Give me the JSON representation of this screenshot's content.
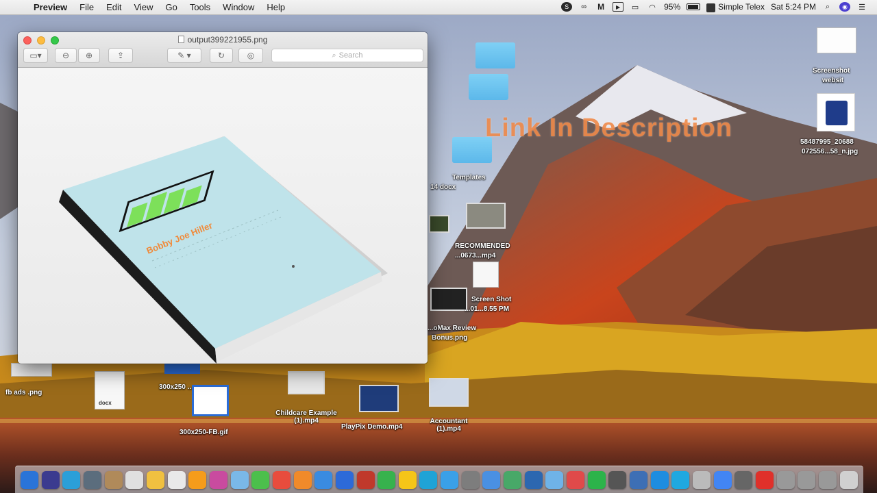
{
  "menubar": {
    "items": [
      "Preview",
      "File",
      "Edit",
      "View",
      "Go",
      "Tools",
      "Window",
      "Help"
    ],
    "battery": "95%",
    "input_source": "Simple Telex",
    "clock": "Sat 5:24 PM"
  },
  "overlay_caption": "Link In Description",
  "window": {
    "title": "output399221955.png",
    "search_placeholder": "Search"
  },
  "book": {
    "cover_title": "Bobby Joe Hiller",
    "colors": {
      "cover": "#bfe3ea",
      "spine": "#1c1c1c",
      "bars": "#7de05a",
      "title_text": "#f08a3a"
    }
  },
  "desktop_icons": {
    "fb_ads": "fb ads .png",
    "size_300x250_top": "300x250 ...",
    "size_300x250_gif": "300x250-FB.gif",
    "docx_label": "docx",
    "childcare": "Childcare Example (1).mp4",
    "playpix": "PlayPix Demo.mp4",
    "accountant": "Accountant (1).mp4",
    "recommended": "RECOMMENDED",
    "recommended_file": "...0673...mp4",
    "screen_shot": "Screen Shot",
    "screen_shot_time": "...01...8.55 PM",
    "review": "...oMax Review",
    "bonus": "Bonus.png",
    "templates": "Templates",
    "templates_count": "14 docx",
    "right_image_name": "58487995_20688",
    "right_image_name2": "072556...58_n.jpg",
    "top_right_label": "Screenshot",
    "top_right_label2": "websit"
  },
  "dock_colors": [
    "#2a74d8",
    "#3b3b8f",
    "#2b9fd8",
    "#5b6d7d",
    "#b08a5a",
    "#e0e0e0",
    "#f0c040",
    "#e9e9e9",
    "#f59c1b",
    "#c94b9f",
    "#7ab8e8",
    "#4cbf4c",
    "#e84c3d",
    "#f08a2a",
    "#3a8be0",
    "#2d6ad8",
    "#c0392b",
    "#37b24d",
    "#f5c518",
    "#1fa3d6",
    "#3aa0e8",
    "#7d7d7d",
    "#4a90e2",
    "#48a868",
    "#2c67b0",
    "#6fb3e8",
    "#e04a4a",
    "#2cb34a",
    "#555555",
    "#3d6fb5",
    "#1e8de0",
    "#1fa8e0",
    "#bbbbbb",
    "#4285f4",
    "#666666",
    "#e0302a",
    "#999999",
    "#999999",
    "#999999",
    "#d0d0d0"
  ]
}
